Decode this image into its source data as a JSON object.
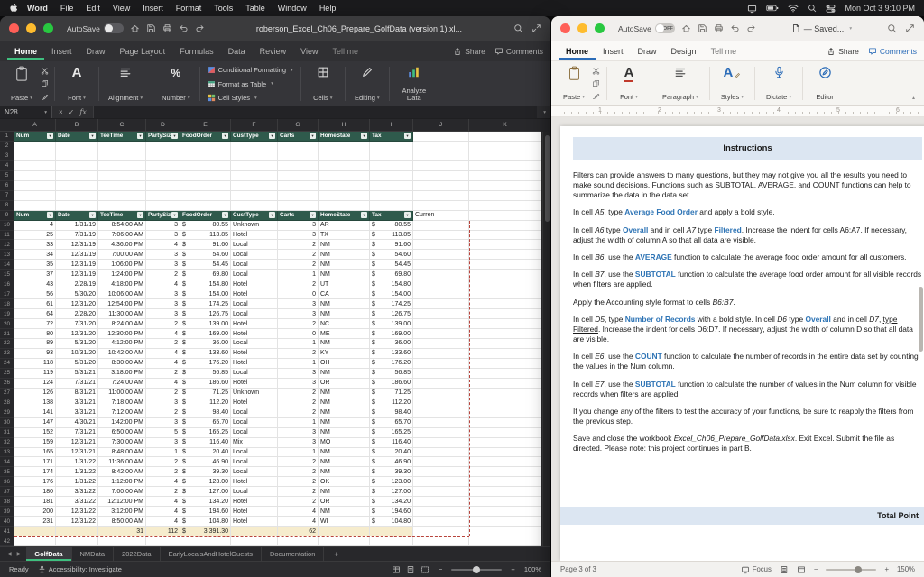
{
  "menubar": {
    "items": [
      "Word",
      "File",
      "Edit",
      "View",
      "Insert",
      "Format",
      "Tools",
      "Table",
      "Window",
      "Help"
    ],
    "clock": "Mon Oct 3  9:10 PM"
  },
  "excel": {
    "titlebar": {
      "autosave_label": "AutoSave",
      "title": "roberson_Excel_Ch06_Prepare_GolfData (version 1).xl..."
    },
    "tabs": [
      "Home",
      "Insert",
      "Draw",
      "Page Layout",
      "Formulas",
      "Data",
      "Review",
      "View",
      "Tell me"
    ],
    "active_tab": "Home",
    "share_label": "Share",
    "comments_label": "Comments",
    "ribbon": {
      "paste": "Paste",
      "font": "Font",
      "alignment": "Alignment",
      "number": "Number",
      "conditional_formatting": "Conditional Formatting",
      "format_as_table": "Format as Table",
      "cell_styles": "Cell Styles",
      "cells": "Cells",
      "editing": "Editing",
      "analyze_data": "Analyze Data"
    },
    "formula_bar": {
      "name_box": "N28",
      "fx": "fx"
    },
    "grid": {
      "col_letters": [
        "A",
        "B",
        "C",
        "D",
        "E",
        "F",
        "G",
        "H",
        "I",
        "J",
        "K"
      ],
      "header_labels": [
        "Num",
        "Date",
        "TeeTime",
        "PartySize",
        "FoodOrder",
        "CustType",
        "Carts",
        "HomeState",
        "Tax"
      ],
      "row9_extra": "Curren",
      "rows": [
        [
          "4",
          "1/31/19",
          "8:54:00 AM",
          "3",
          "80.55",
          "Unknown",
          "3",
          "AR",
          "80.55"
        ],
        [
          "25",
          "7/31/19",
          "7:06:00 AM",
          "3",
          "113.85",
          "Hotel",
          "3",
          "TX",
          "113.85"
        ],
        [
          "33",
          "12/31/19",
          "4:36:00 PM",
          "4",
          "91.60",
          "Local",
          "2",
          "NM",
          "91.60"
        ],
        [
          "34",
          "12/31/19",
          "7:00:00 AM",
          "3",
          "54.60",
          "Local",
          "2",
          "NM",
          "54.60"
        ],
        [
          "35",
          "12/31/19",
          "1:06:00 PM",
          "3",
          "54.45",
          "Local",
          "2",
          "NM",
          "54.45"
        ],
        [
          "37",
          "12/31/19",
          "1:24:00 PM",
          "2",
          "69.80",
          "Local",
          "1",
          "NM",
          "69.80"
        ],
        [
          "43",
          "2/28/19",
          "4:18:00 PM",
          "4",
          "154.80",
          "Hotel",
          "2",
          "UT",
          "154.80"
        ],
        [
          "56",
          "5/30/20",
          "10:06:00 AM",
          "3",
          "154.00",
          "Hotel",
          "0",
          "CA",
          "154.00"
        ],
        [
          "61",
          "12/31/20",
          "12:54:00 PM",
          "3",
          "174.25",
          "Local",
          "3",
          "NM",
          "174.25"
        ],
        [
          "64",
          "2/28/20",
          "11:30:00 AM",
          "3",
          "126.75",
          "Local",
          "3",
          "NM",
          "126.75"
        ],
        [
          "72",
          "7/31/20",
          "8:24:00 AM",
          "2",
          "139.00",
          "Hotel",
          "2",
          "NC",
          "139.00"
        ],
        [
          "80",
          "12/31/20",
          "12:30:00 PM",
          "4",
          "169.00",
          "Hotel",
          "0",
          "ME",
          "169.00"
        ],
        [
          "89",
          "5/31/20",
          "4:12:00 PM",
          "2",
          "36.00",
          "Local",
          "1",
          "NM",
          "36.00"
        ],
        [
          "93",
          "10/31/20",
          "10:42:00 AM",
          "4",
          "133.60",
          "Hotel",
          "2",
          "KY",
          "133.60"
        ],
        [
          "118",
          "5/31/20",
          "8:30:00 AM",
          "4",
          "176.20",
          "Hotel",
          "1",
          "OH",
          "176.20"
        ],
        [
          "119",
          "5/31/21",
          "3:18:00 PM",
          "2",
          "56.85",
          "Local",
          "3",
          "NM",
          "56.85"
        ],
        [
          "124",
          "7/31/21",
          "7:24:00 AM",
          "4",
          "186.60",
          "Hotel",
          "3",
          "OR",
          "186.60"
        ],
        [
          "126",
          "8/31/21",
          "11:00:00 AM",
          "2",
          "71.25",
          "Unknown",
          "2",
          "NM",
          "71.25"
        ],
        [
          "138",
          "3/31/21",
          "7:18:00 AM",
          "3",
          "112.20",
          "Hotel",
          "2",
          "NM",
          "112.20"
        ],
        [
          "141",
          "3/31/21",
          "7:12:00 AM",
          "2",
          "98.40",
          "Local",
          "2",
          "NM",
          "98.40"
        ],
        [
          "147",
          "4/30/21",
          "1:42:00 PM",
          "3",
          "65.70",
          "Local",
          "1",
          "NM",
          "65.70"
        ],
        [
          "152",
          "7/31/21",
          "6:50:00 AM",
          "5",
          "165.25",
          "Local",
          "3",
          "NM",
          "165.25"
        ],
        [
          "159",
          "12/31/21",
          "7:30:00 AM",
          "3",
          "116.40",
          "Mix",
          "3",
          "MO",
          "116.40"
        ],
        [
          "165",
          "12/31/21",
          "8:48:00 AM",
          "1",
          "20.40",
          "Local",
          "1",
          "NM",
          "20.40"
        ],
        [
          "171",
          "1/31/22",
          "11:36:00 AM",
          "2",
          "46.90",
          "Local",
          "2",
          "NM",
          "46.90"
        ],
        [
          "174",
          "1/31/22",
          "8:42:00 AM",
          "2",
          "39.30",
          "Local",
          "2",
          "NM",
          "39.30"
        ],
        [
          "176",
          "1/31/22",
          "1:12:00 PM",
          "4",
          "123.00",
          "Hotel",
          "2",
          "OK",
          "123.00"
        ],
        [
          "180",
          "3/31/22",
          "7:00:00 AM",
          "2",
          "127.00",
          "Local",
          "2",
          "NM",
          "127.00"
        ],
        [
          "181",
          "3/31/22",
          "12:12:00 PM",
          "4",
          "134.20",
          "Hotel",
          "2",
          "OR",
          "134.20"
        ],
        [
          "200",
          "12/31/22",
          "3:12:00 PM",
          "4",
          "194.60",
          "Hotel",
          "4",
          "NM",
          "194.60"
        ],
        [
          "231",
          "12/31/22",
          "8:50:00 AM",
          "4",
          "104.80",
          "Hotel",
          "4",
          "WI",
          "104.80"
        ]
      ],
      "totals": {
        "c": "31",
        "d": "112",
        "e": "3,391.30",
        "g": "62"
      }
    },
    "sheet_tabs": [
      "GolfData",
      "NMData",
      "2022Data",
      "EarlyLocalsAndHotelGuests",
      "Documentation"
    ],
    "active_sheet": "GolfData",
    "status": {
      "ready": "Ready",
      "accessibility": "Accessibility: Investigate",
      "zoom": "100%"
    }
  },
  "word": {
    "titlebar": {
      "autosave_label": "AutoSave",
      "autosave_state": "OFF",
      "title": "— Saved..."
    },
    "tabs": [
      "Home",
      "Insert",
      "Draw",
      "Design",
      "Tell me"
    ],
    "active_tab": "Home",
    "share_label": "Share",
    "comments_label": "Comments",
    "ribbon": {
      "paste": "Paste",
      "font": "Font",
      "paragraph": "Paragraph",
      "styles": "Styles",
      "dictate": "Dictate",
      "editor": "Editor"
    },
    "ruler_numbers": [
      "1",
      "2",
      "3",
      "4",
      "5",
      "6"
    ],
    "doc": {
      "header": "Instructions",
      "paragraphs": [
        [
          {
            "t": "Filters can provide answers to many questions, but they may not give you all the results you need to make sound decisions. Functions such as SUBTOTAL, AVERAGE, and COUNT functions can help to summarize the data in the data set.",
            "s": "n"
          }
        ],
        [
          {
            "t": "In cell ",
            "s": "n"
          },
          {
            "t": "A5",
            "s": "i"
          },
          {
            "t": ", type ",
            "s": "n"
          },
          {
            "t": "Average Food Order",
            "s": "bb"
          },
          {
            "t": " and apply a bold style.",
            "s": "n"
          }
        ],
        [
          {
            "t": "In cell ",
            "s": "n"
          },
          {
            "t": "A6",
            "s": "i"
          },
          {
            "t": " type ",
            "s": "n"
          },
          {
            "t": "Overall",
            "s": "bb"
          },
          {
            "t": " and in cell ",
            "s": "n"
          },
          {
            "t": "A7",
            "s": "i"
          },
          {
            "t": " type ",
            "s": "n"
          },
          {
            "t": "Filtered",
            "s": "bb"
          },
          {
            "t": ". Increase the indent for cells A6:A7. If necessary, adjust the width of column A so that all data are visible.",
            "s": "n"
          }
        ],
        [
          {
            "t": "In cell ",
            "s": "n"
          },
          {
            "t": "B6",
            "s": "i"
          },
          {
            "t": ", use the ",
            "s": "n"
          },
          {
            "t": "AVERAGE",
            "s": "bb"
          },
          {
            "t": " function to calculate the average food order amount for all customers.",
            "s": "n"
          }
        ],
        [
          {
            "t": "In cell ",
            "s": "n"
          },
          {
            "t": "B7",
            "s": "i"
          },
          {
            "t": ", use the ",
            "s": "n"
          },
          {
            "t": "SUBTOTAL",
            "s": "bb"
          },
          {
            "t": " function to calculate the average food order amount for all visible records when filters are applied.",
            "s": "n"
          }
        ],
        [
          {
            "t": "Apply the Accounting style format to cells ",
            "s": "n"
          },
          {
            "t": "B6:B7",
            "s": "i"
          },
          {
            "t": ".",
            "s": "n"
          }
        ],
        [
          {
            "t": "In cell ",
            "s": "n"
          },
          {
            "t": "D5",
            "s": "i"
          },
          {
            "t": ", type ",
            "s": "n"
          },
          {
            "t": "Number of Records",
            "s": "bb"
          },
          {
            "t": " with a bold style.  In cell ",
            "s": "n"
          },
          {
            "t": "D6",
            "s": "i"
          },
          {
            "t": " type ",
            "s": "n"
          },
          {
            "t": "Overall",
            "s": "bb"
          },
          {
            "t": " and in cell ",
            "s": "n"
          },
          {
            "t": "D7",
            "s": "i"
          },
          {
            "t": ", ",
            "s": "n"
          },
          {
            "t": "type Filtered",
            "s": "u"
          },
          {
            "t": ". Increase the indent for cells D6:D7. If necessary, adjust the width of column D so that all data are visible.",
            "s": "n"
          }
        ],
        [
          {
            "t": "In cell ",
            "s": "n"
          },
          {
            "t": "E6",
            "s": "i"
          },
          {
            "t": ", use the ",
            "s": "n"
          },
          {
            "t": "COUNT",
            "s": "bb"
          },
          {
            "t": " function to calculate the number of records in the entire data set by counting the values in the Num column.",
            "s": "n"
          }
        ],
        [
          {
            "t": "In cell ",
            "s": "n"
          },
          {
            "t": "E7",
            "s": "i"
          },
          {
            "t": ", use the ",
            "s": "n"
          },
          {
            "t": "SUBTOTAL",
            "s": "bb"
          },
          {
            "t": " function to calculate the number of values in the Num column for visible records when filters are applied.",
            "s": "n"
          }
        ],
        [
          {
            "t": "If you change any of the filters to test the accuracy of your functions, be sure to reapply the filters from the previous step.",
            "s": "n"
          }
        ],
        [
          {
            "t": "Save and close the workbook ",
            "s": "n"
          },
          {
            "t": "Excel_Ch06_Prepare_GolfData.xlsx",
            "s": "i"
          },
          {
            "t": ". Exit Excel. Submit the file as directed.  Please note: this project continues in part B.",
            "s": "n"
          }
        ]
      ],
      "footer_band": "Total Point"
    },
    "status": {
      "page": "Page 3 of 3",
      "focus": "Focus",
      "zoom": "150%"
    }
  }
}
